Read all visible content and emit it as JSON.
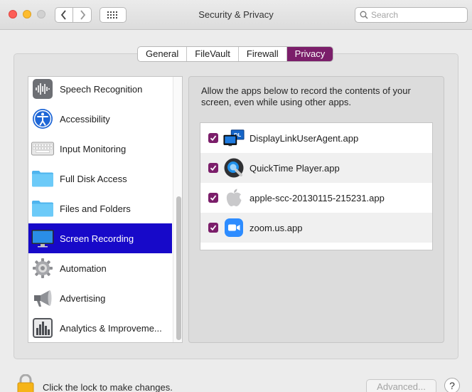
{
  "window": {
    "title": "Security & Privacy"
  },
  "search": {
    "placeholder": "Search"
  },
  "tabs": [
    {
      "label": "General"
    },
    {
      "label": "FileVault"
    },
    {
      "label": "Firewall"
    },
    {
      "label": "Privacy",
      "selected": true
    }
  ],
  "sidebar": {
    "items": [
      {
        "label": "Speech Recognition",
        "icon": "waveform-icon"
      },
      {
        "label": "Accessibility",
        "icon": "accessibility-icon"
      },
      {
        "label": "Input Monitoring",
        "icon": "keyboard-icon"
      },
      {
        "label": "Full Disk Access",
        "icon": "folder-icon"
      },
      {
        "label": "Files and Folders",
        "icon": "folder-icon"
      },
      {
        "label": "Screen Recording",
        "icon": "display-icon",
        "selected": true
      },
      {
        "label": "Automation",
        "icon": "gear-icon"
      },
      {
        "label": "Advertising",
        "icon": "megaphone-icon"
      },
      {
        "label": "Analytics & Improveme...",
        "icon": "bar-chart-icon"
      }
    ]
  },
  "main": {
    "description": "Allow the apps below to record the contents of your screen, even while using other apps.",
    "apps": [
      {
        "name": "DisplayLinkUserAgent.app",
        "checked": true,
        "icon": "displaylink-icon"
      },
      {
        "name": "QuickTime Player.app",
        "checked": true,
        "icon": "quicktime-icon"
      },
      {
        "name": "apple-scc-20130115-215231.app",
        "checked": true,
        "icon": "apple-icon"
      },
      {
        "name": "zoom.us.app",
        "checked": true,
        "icon": "zoom-camera-icon"
      }
    ]
  },
  "footer": {
    "lock_text": "Click the lock to make changes.",
    "advanced_label": "Advanced...",
    "help_label": "?"
  },
  "colors": {
    "accent": "#7b1e6a",
    "selection": "#1709c9"
  }
}
